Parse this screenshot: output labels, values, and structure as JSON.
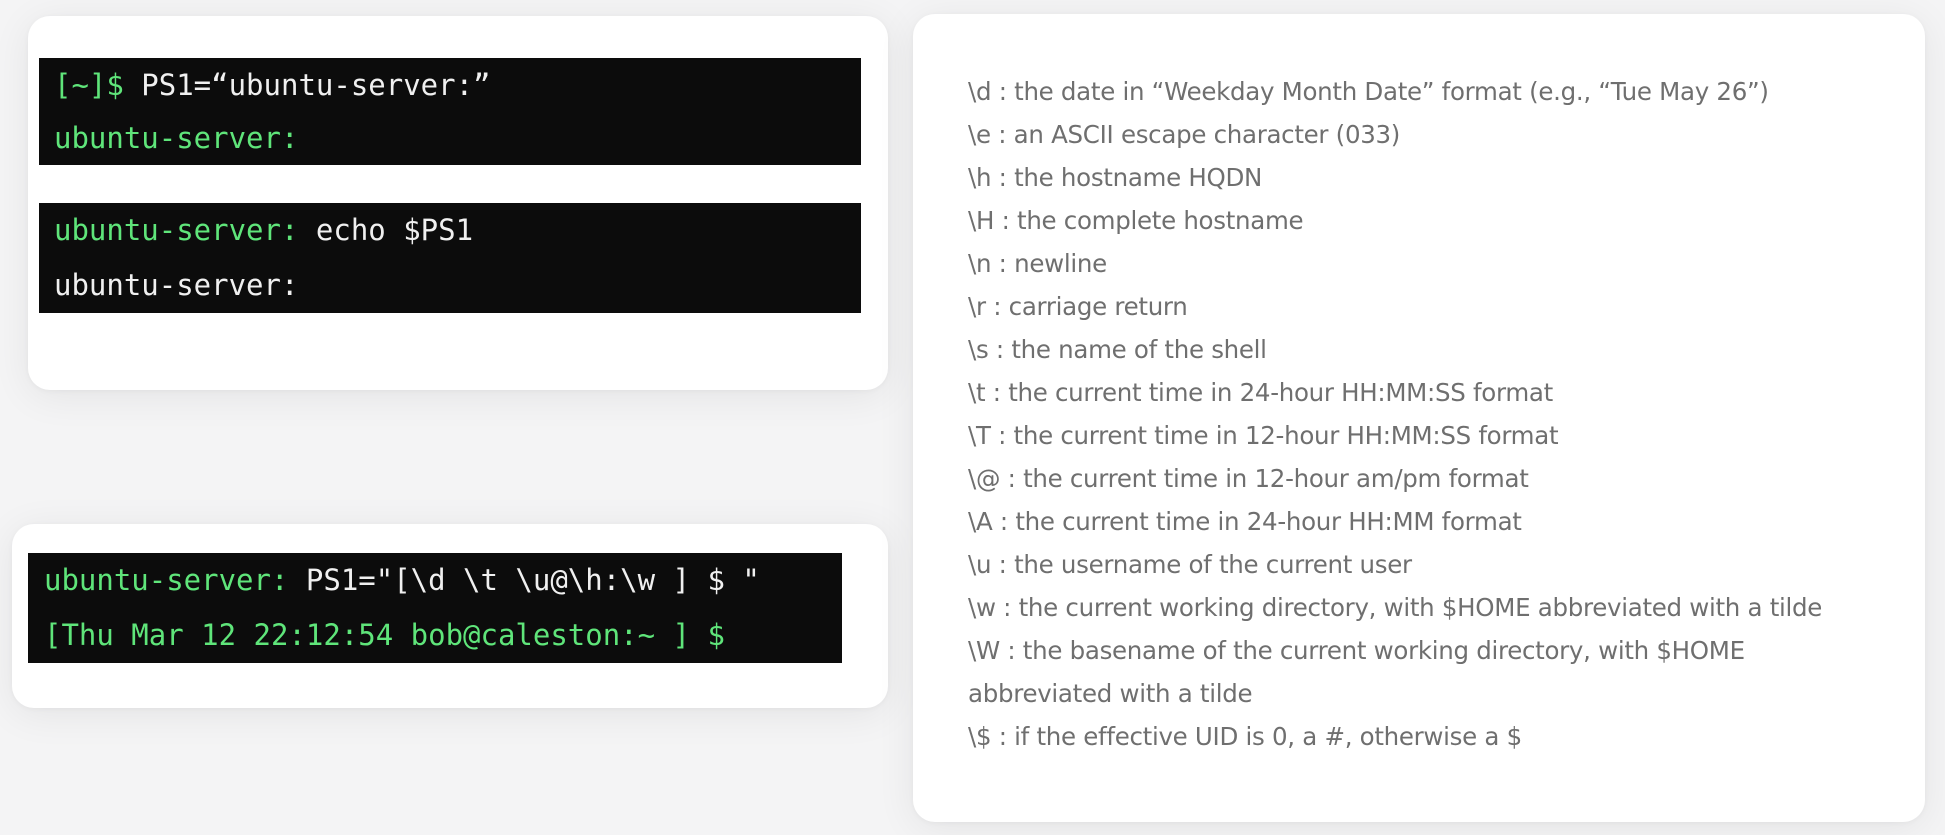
{
  "panels": {
    "top_left": {
      "terminal_1": {
        "prompt": "[~]$",
        "command": " PS1=“ubuntu-server:”",
        "output_prompt": "ubuntu-server:"
      },
      "terminal_2": {
        "prompt": "ubuntu-server:",
        "command": " echo $PS1",
        "output": "ubuntu-server:"
      }
    },
    "bottom_left": {
      "terminal_3": {
        "prompt": "ubuntu-server:",
        "command": " PS1=\"[\\d \\t \\u@\\h:\\w ] $ \"",
        "result_prompt": "[Thu Mar 12 22:12:54 bob@caleston:~ ] $"
      }
    },
    "right": {
      "escape_sequences": [
        "\\d : the date in “Weekday Month Date” format (e.g., “Tue May 26”)",
        "\\e : an ASCII escape character (033)",
        "\\h : the hostname HQDN",
        "\\H : the complete hostname",
        "\\n : newline",
        "\\r : carriage return",
        "\\s : the name of the shell",
        "\\t : the current time in 24-hour HH:MM:SS format",
        "\\T : the current time in 12-hour HH:MM:SS format",
        "\\@ : the current time in 12-hour am/pm format",
        "\\A : the current time in 24-hour HH:MM format",
        "\\u : the username of the current user",
        "\\w : the current working directory, with $HOME abbreviated with a tilde",
        "\\W : the basename of the current working directory, with $HOME abbreviated with a tilde",
        "\\$ : if the effective UID is 0, a #, otherwise a $"
      ]
    }
  },
  "colors": {
    "terminal_background": "#0c0c0c",
    "prompt_green": "#5fe57a",
    "terminal_text": "#f0f0f0",
    "reference_text": "#6f6f6f",
    "card_background": "#ffffff",
    "page_background": "#f4f4f5"
  }
}
